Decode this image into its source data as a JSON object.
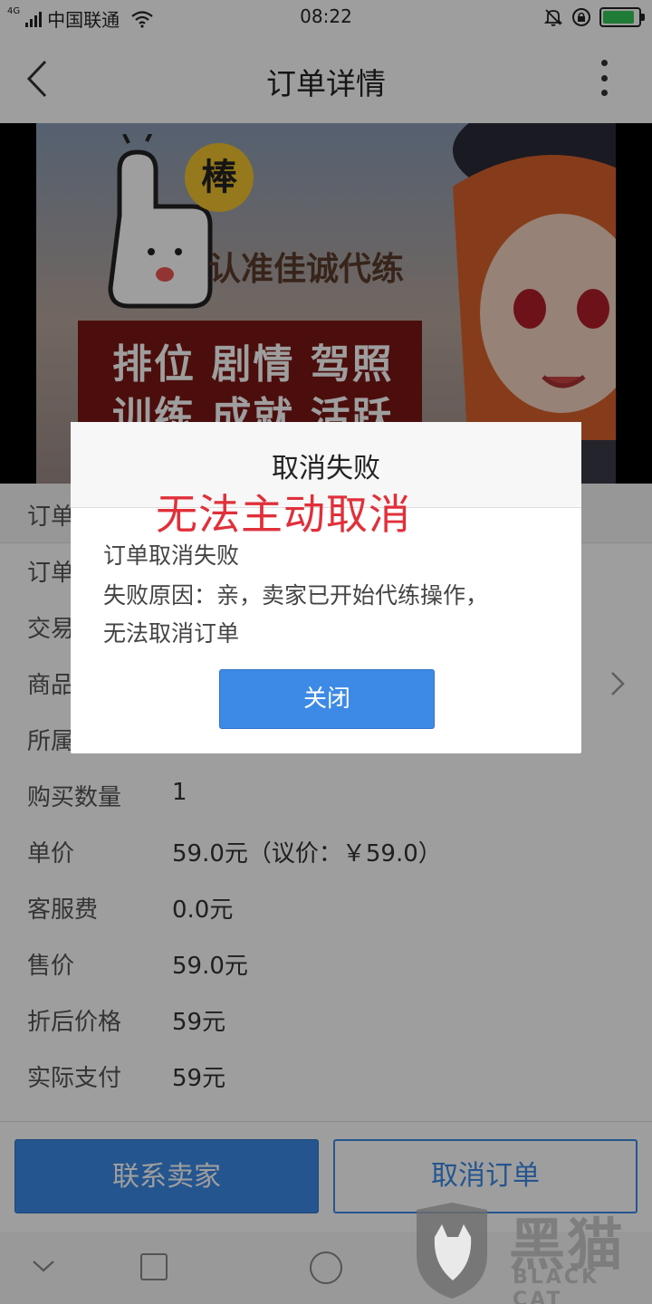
{
  "status_bar": {
    "network_type": "4G",
    "carrier": "中国联通",
    "time": "08:22",
    "battery_percent": 90,
    "icons": [
      "signal-icon",
      "wifi-icon",
      "mute-icon",
      "orientation-lock-icon",
      "battery-charging-icon"
    ]
  },
  "nav": {
    "title": "订单详情",
    "back_icon": "chevron-left-icon",
    "more_icon": "more-vertical-icon"
  },
  "banner": {
    "badge": "棒",
    "tagline": "认准佳诚代练",
    "line1": "排位 剧情 驾照",
    "line2": "训练 成就 活跃"
  },
  "order_header": {
    "label": "订单"
  },
  "info_rows": [
    {
      "label": "订单",
      "value": ""
    },
    {
      "label": "交易",
      "value": ""
    },
    {
      "label": "商品",
      "value": ""
    },
    {
      "label": "所属",
      "value": ""
    },
    {
      "label": "购买数量",
      "value": "1"
    },
    {
      "label": "单价",
      "value": "59.0元（议价：￥59.0）"
    },
    {
      "label": "客服费",
      "value": "0.0元"
    },
    {
      "label": "售价",
      "value": "59.0元"
    },
    {
      "label": "折后价格",
      "value": "59元"
    },
    {
      "label": "实际支付",
      "value": "59元"
    }
  ],
  "actions": {
    "contact_seller": "联系卖家",
    "cancel_order": "取消订单"
  },
  "dialog": {
    "title": "取消失败",
    "line1": "订单取消失败",
    "line2": "失败原因：亲，卖家已开始代练操作，",
    "line3": "无法取消订单",
    "close": "关闭"
  },
  "annotation": "无法主动取消",
  "watermark": {
    "cn": "黑猫",
    "en": "BLACK CAT"
  },
  "colors": {
    "primary": "#3d8ae6",
    "annotation_red": "#e0303a",
    "battery_green": "#34c759"
  }
}
